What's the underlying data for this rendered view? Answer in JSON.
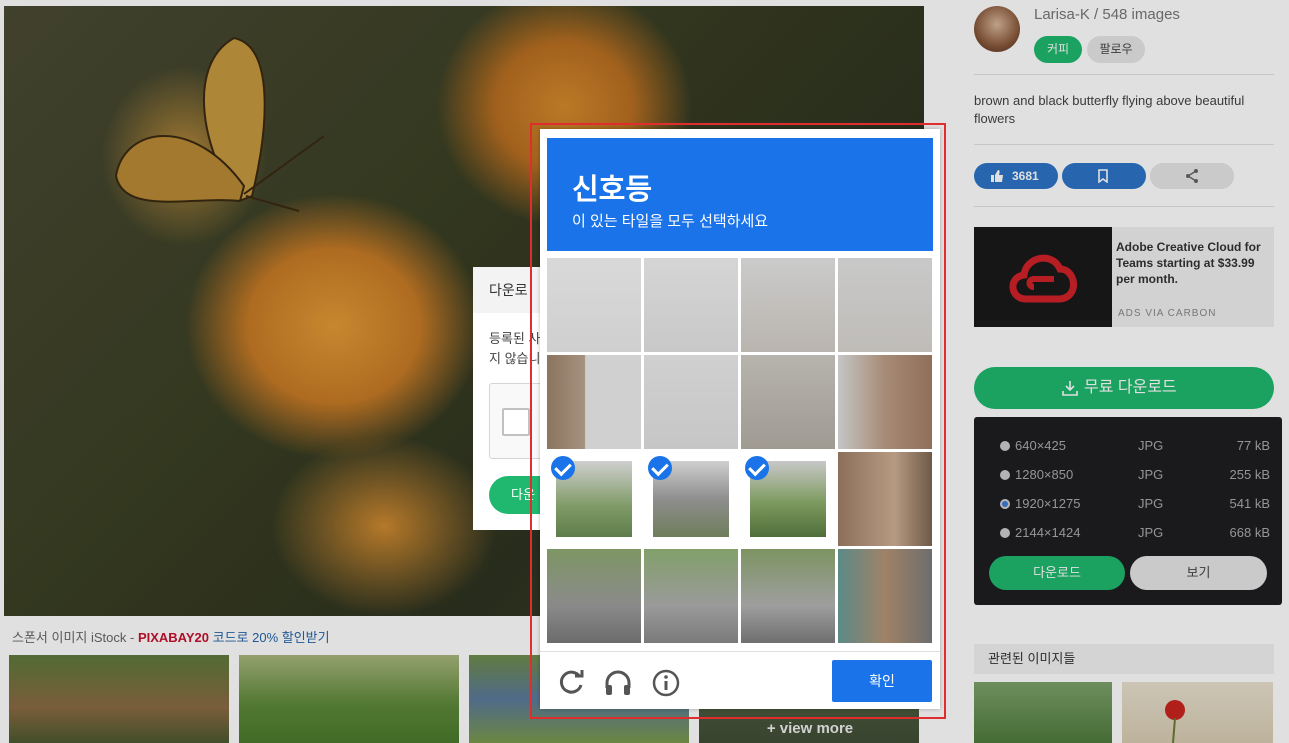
{
  "hero": {
    "alt_icon": "butterfly-photo"
  },
  "sponsor": {
    "prefix": "스폰서 이미지 iStock - ",
    "code": "PIXABAY20",
    "suffix": " 코드로 20% 할인받기"
  },
  "view_more": "+ view more",
  "author": {
    "name": "Larisa-K / 548 images",
    "coffee": "커피",
    "follow": "팔로우"
  },
  "description": "brown and black butterfly flying above beautiful flowers",
  "actions": {
    "likes": "3681"
  },
  "ad": {
    "text": "Adobe Creative Cloud for Teams starting at $33.99 per month.",
    "via": "ADS VIA CARBON"
  },
  "download": {
    "main_label": "무료 다운로드",
    "options": [
      {
        "res": "640×425",
        "fmt": "JPG",
        "size": "77 kB",
        "selected": false
      },
      {
        "res": "1280×850",
        "fmt": "JPG",
        "size": "255 kB",
        "selected": false
      },
      {
        "res": "1920×1275",
        "fmt": "JPG",
        "size": "541 kB",
        "selected": true
      },
      {
        "res": "2144×1424",
        "fmt": "JPG",
        "size": "668 kB",
        "selected": false
      }
    ],
    "download_btn": "다운로드",
    "view_btn": "보기"
  },
  "related_title": "관련된 이미지들",
  "dialog": {
    "head": "다운로",
    "line1": "등록된 사",
    "line2": "지 않습니",
    "btn": "다운"
  },
  "captcha": {
    "title": "신호등",
    "subtitle": "이 있는 타일을 모두 선택하세요",
    "selected_tiles": [
      8,
      9,
      10
    ],
    "verify": "확인"
  },
  "colors": {
    "accent_green": "#1fb86e",
    "captcha_blue": "#1a73e8",
    "frame_red": "#e02d2d",
    "like_blue": "#2d74c8"
  }
}
